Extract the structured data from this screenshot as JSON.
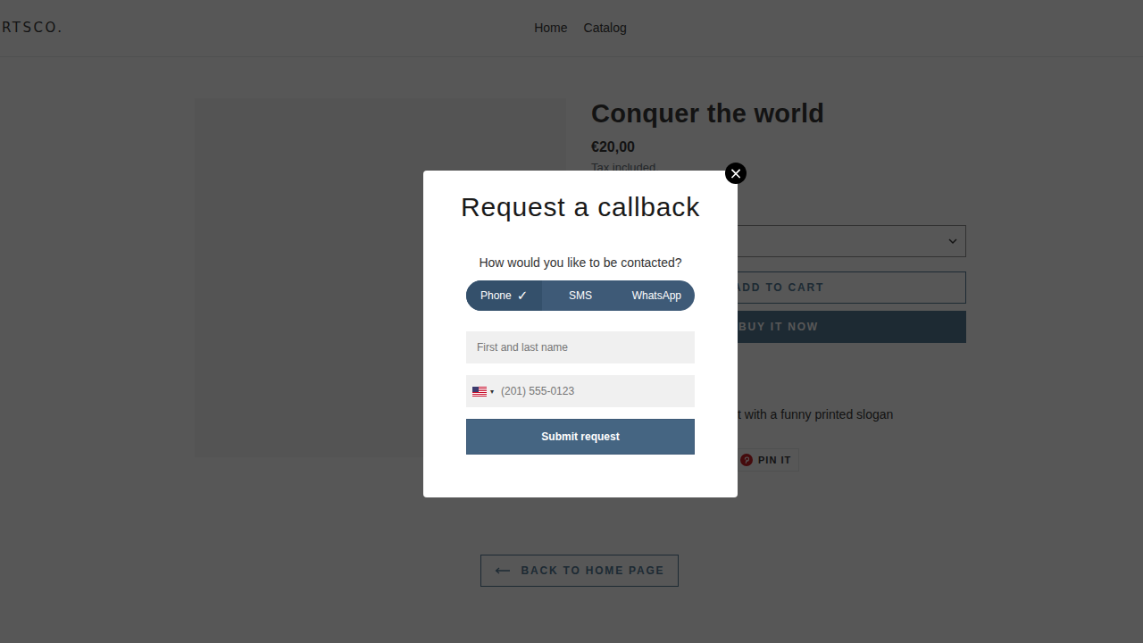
{
  "store": {
    "logo": "RTSCO.",
    "nav": [
      {
        "label": "Home"
      },
      {
        "label": "Catalog"
      }
    ]
  },
  "product": {
    "title": "Conquer the world",
    "price": "€20,00",
    "tax_note": "Tax included.",
    "add_to_cart": "ADD TO CART",
    "buy_now": "BUY IT NOW",
    "description": "t with a funny printed slogan",
    "share": [
      {
        "label": "PIN IT"
      }
    ]
  },
  "back_link": "BACK TO HOME PAGE",
  "dialog": {
    "title": "Request a callback",
    "close": "×",
    "question": "How would you like to be contacted?",
    "methods": [
      {
        "label": "Phone",
        "selected": true
      },
      {
        "label": "SMS",
        "selected": false
      },
      {
        "label": "WhatsApp",
        "selected": false
      }
    ],
    "check": "✓",
    "name_placeholder": "First and last name",
    "phone": {
      "caret": "▾",
      "placeholder": "(201) 555-0123"
    },
    "submit": "Submit request"
  }
}
